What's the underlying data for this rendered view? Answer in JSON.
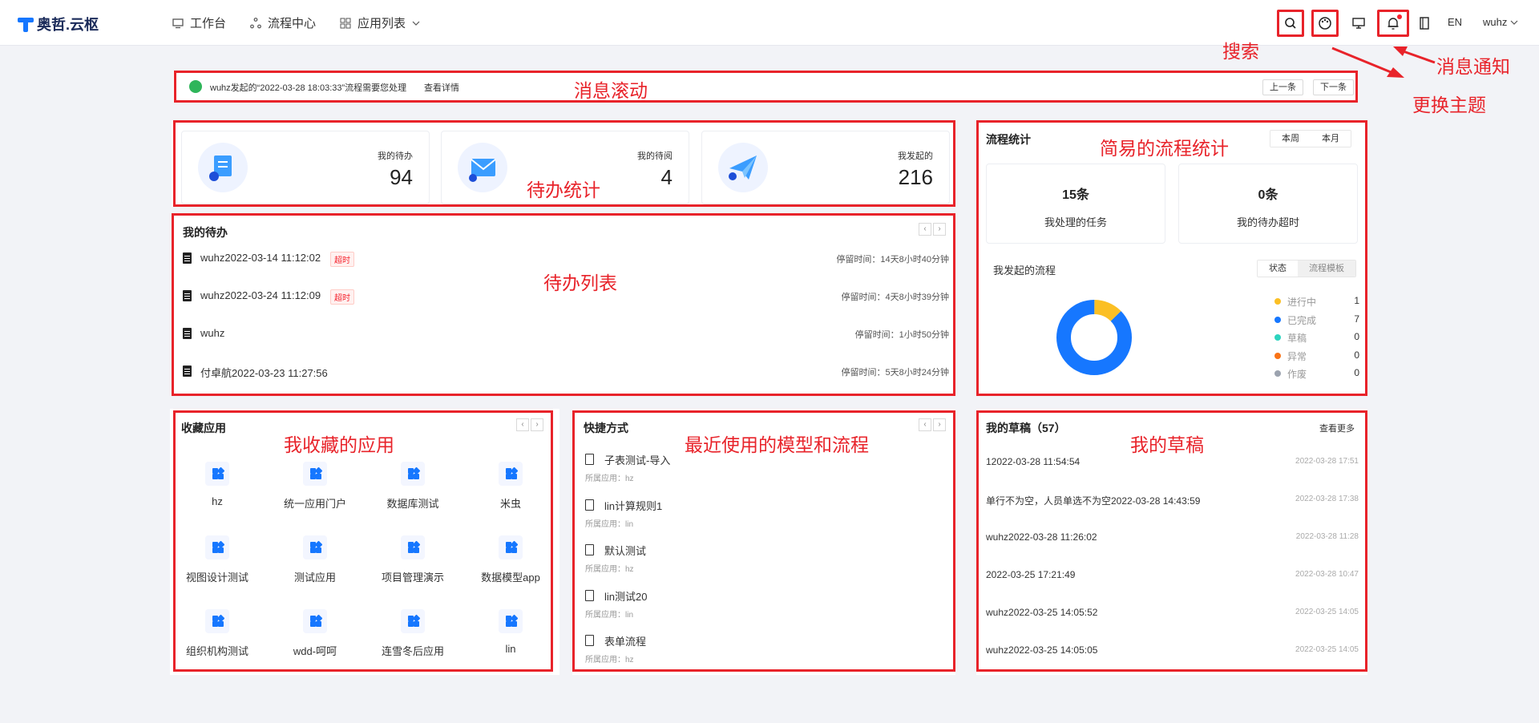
{
  "header": {
    "logo_text": "奥哲.云枢",
    "nav": [
      {
        "label": "工作台",
        "icon": "monitor-icon"
      },
      {
        "label": "流程中心",
        "icon": "flow-icon"
      },
      {
        "label": "应用列表",
        "icon": "apps-grid-icon"
      }
    ],
    "lang": "EN",
    "user": "wuhz"
  },
  "annotations": {
    "search": "搜索",
    "theme": "更换主题",
    "notify": "消息通知",
    "ticker": "消息滚动",
    "todo_stats": "待办统计",
    "flow_stats": "简易的流程统计",
    "todo_list": "待办列表",
    "fav_apps": "我收藏的应用",
    "recent": "最近使用的模型和流程",
    "drafts": "我的草稿"
  },
  "ticker": {
    "text": "wuhz发起的“2022-03-28 18:03:33”流程需要您处理",
    "link": "查看详情",
    "prev": "上一条",
    "next": "下一条"
  },
  "stats": [
    {
      "label": "我的待办",
      "value": "94"
    },
    {
      "label": "我的待阅",
      "value": "4"
    },
    {
      "label": "我发起的",
      "value": "216"
    }
  ],
  "todo": {
    "title": "我的待办",
    "items": [
      {
        "title": "wuhz2022-03-14 11:12:02",
        "overdue": "超时",
        "stay": "停留时间：14天8小时40分钟"
      },
      {
        "title": "wuhz2022-03-24 11:12:09",
        "overdue": "超时",
        "stay": "停留时间：4天8小时39分钟"
      },
      {
        "title": "wuhz",
        "overdue": "",
        "stay": "停留时间：1小时50分钟"
      },
      {
        "title": "付卓航2022-03-23 11:27:56",
        "overdue": "",
        "stay": "停留时间：5天8小时24分钟"
      }
    ]
  },
  "flow_stats": {
    "title": "流程统计",
    "tabs": [
      "本周",
      "本月"
    ],
    "cards": [
      {
        "value": "15条",
        "label": "我处理的任务"
      },
      {
        "value": "0条",
        "label": "我的待办超时"
      }
    ],
    "started_title": "我发起的流程",
    "seg": [
      "状态",
      "流程模板"
    ],
    "legend": [
      {
        "name": "进行中",
        "value": 1,
        "color": "#fbbf24"
      },
      {
        "name": "已完成",
        "value": 7,
        "color": "#1677ff"
      },
      {
        "name": "草稿",
        "value": 0,
        "color": "#2dd4bf"
      },
      {
        "name": "异常",
        "value": 0,
        "color": "#f97316"
      },
      {
        "name": "作废",
        "value": 0,
        "color": "#9ca3af"
      }
    ]
  },
  "fav_apps": {
    "title": "收藏应用",
    "items": [
      {
        "name": "hz"
      },
      {
        "name": "统一应用门户"
      },
      {
        "name": "数据库测试"
      },
      {
        "name": "米虫"
      },
      {
        "name": "视图设计测试"
      },
      {
        "name": "测试应用"
      },
      {
        "name": "项目管理演示"
      },
      {
        "name": "数据模型app"
      },
      {
        "name": "组织机构测试"
      },
      {
        "name": "wdd-呵呵"
      },
      {
        "name": "连雪冬后应用"
      },
      {
        "name": "lin"
      }
    ]
  },
  "shortcuts": {
    "title": "快捷方式",
    "items": [
      {
        "title": "子表测试-导入",
        "sub": "所属应用：hz"
      },
      {
        "title": "lin计算规则1",
        "sub": "所属应用：lin"
      },
      {
        "title": "默认测试",
        "sub": "所属应用：hz"
      },
      {
        "title": "lin测试20",
        "sub": "所属应用：lin"
      },
      {
        "title": "表单流程",
        "sub": "所属应用：hz"
      }
    ]
  },
  "drafts": {
    "title": "我的草稿（57）",
    "more": "查看更多",
    "items": [
      {
        "title": "12022-03-28 11:54:54",
        "date": "2022-03-28 17:51"
      },
      {
        "title": "单行不为空，人员单选不为空2022-03-28 14:43:59",
        "date": "2022-03-28 17:38"
      },
      {
        "title": "wuhz2022-03-28 11:26:02",
        "date": "2022-03-28 11:28"
      },
      {
        "title": "2022-03-25 17:21:49",
        "date": "2022-03-28 10:47"
      },
      {
        "title": "wuhz2022-03-25 14:05:52",
        "date": "2022-03-25 14:05"
      },
      {
        "title": "wuhz2022-03-25 14:05:05",
        "date": "2022-03-25 14:05"
      }
    ]
  }
}
